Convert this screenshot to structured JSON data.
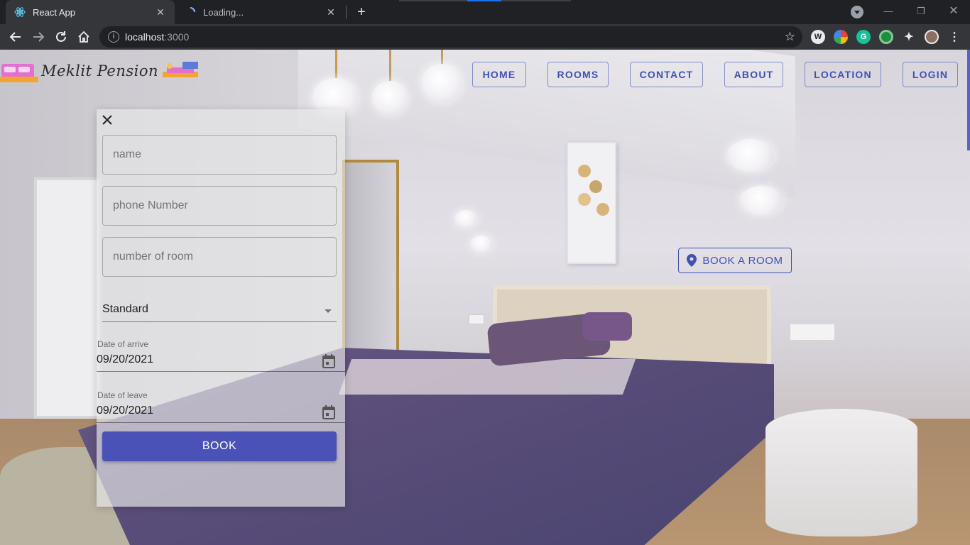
{
  "browser": {
    "tabs": [
      {
        "title": "React App",
        "icon": "react-icon",
        "active": true
      },
      {
        "title": "Loading...",
        "icon": "loading-spinner-icon",
        "active": false
      }
    ],
    "url_host": "localhost",
    "url_port": ":3000"
  },
  "header": {
    "brand": "Meklit Pension",
    "nav": [
      "HOME",
      "ROOMS",
      "CONTACT",
      "ABOUT",
      "LOCATION",
      "LOGIN"
    ]
  },
  "hero": {
    "book_room_label": "BOOK A ROOM"
  },
  "booking_form": {
    "name_placeholder": "name",
    "phone_placeholder": "phone Number",
    "rooms_placeholder": "number of room",
    "room_type": "Standard",
    "arrive_label": "Date of arrive",
    "arrive_value": "09/20/2021",
    "leave_label": "Date of leave",
    "leave_value": "09/20/2021",
    "submit_label": "BOOK"
  },
  "colors": {
    "accent": "#3f51b5",
    "button": "#4a52b7",
    "chrome_dark": "#202124",
    "chrome_toolbar": "#35363a"
  }
}
